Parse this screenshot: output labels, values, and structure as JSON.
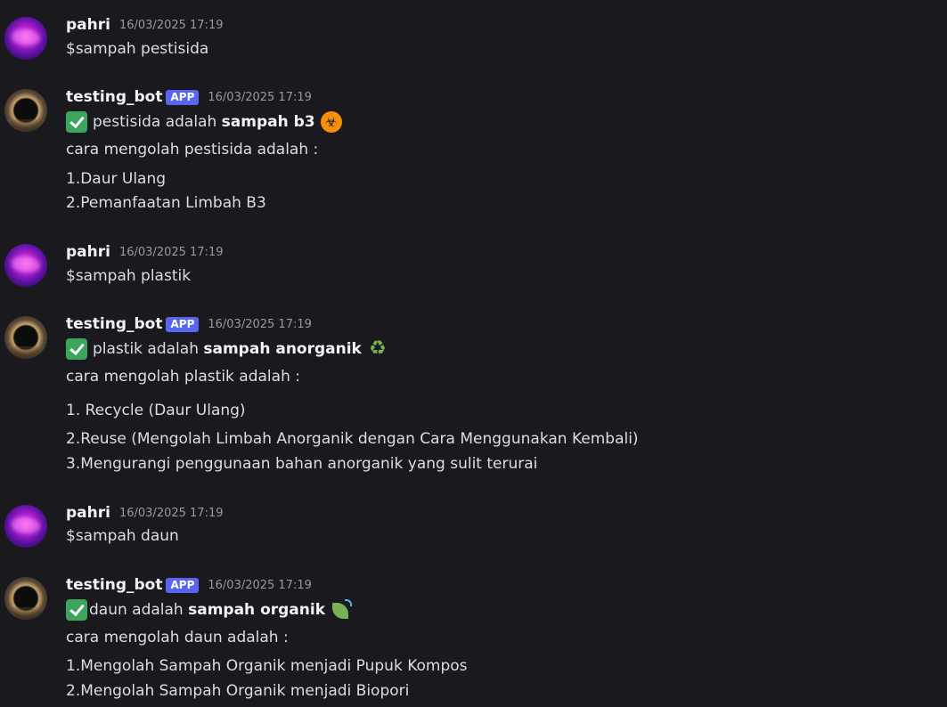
{
  "messages": [
    {
      "username": "pahri",
      "timestamp": "16/03/2025 17:19",
      "text": "$sampah pestisida"
    },
    {
      "username": "testing_bot",
      "badge": "APP",
      "timestamp": "16/03/2025 17:19",
      "result_prefix": "pestisida adalah ",
      "result_bold": "sampah b3",
      "result_icon": "biohazard-icon",
      "intro": "cara mengolah pestisida adalah :",
      "items": [
        "1.Daur Ulang",
        "2.Pemanfaatan Limbah B3"
      ]
    },
    {
      "username": "pahri",
      "timestamp": "16/03/2025 17:19",
      "text": "$sampah plastik"
    },
    {
      "username": "testing_bot",
      "badge": "APP",
      "timestamp": "16/03/2025 17:19",
      "result_prefix": "plastik adalah ",
      "result_bold": "sampah anorganik",
      "result_icon": "recycle-icon",
      "intro": "cara mengolah plastik adalah :",
      "items": [
        "1. Recycle (Daur Ulang)",
        "2.Reuse (Mengolah Limbah Anorganik dengan Cara Menggunakan Kembali)",
        "3.Mengurangi penggunaan bahan anorganik yang sulit terurai"
      ]
    },
    {
      "username": "pahri",
      "timestamp": "16/03/2025 17:19",
      "text": "$sampah daun"
    },
    {
      "username": "testing_bot",
      "badge": "APP",
      "timestamp": "16/03/2025 17:19",
      "result_prefix": "daun adalah ",
      "result_bold": "sampah organik",
      "result_icon": "leaf-icon",
      "intro": "cara mengolah daun adalah :",
      "items": [
        "1.Mengolah Sampah Organik menjadi Pupuk Kompos",
        "2.Mengolah Sampah Organik menjadi Biopori"
      ]
    }
  ],
  "icons": {
    "check": "white-heavy-check-mark",
    "recycle_glyph": "♻"
  },
  "colors": {
    "background": "#1a1a1e",
    "badge": "#5865f2",
    "timestamp": "#949ba4",
    "text": "#dbdee1",
    "check": "#3ba55c"
  }
}
